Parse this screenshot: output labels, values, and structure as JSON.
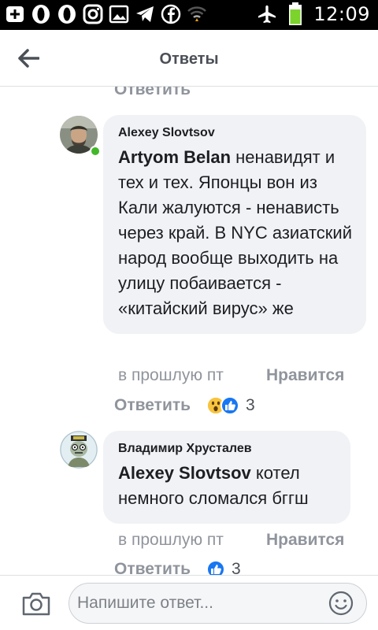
{
  "status_bar": {
    "time": "12:09",
    "icons": [
      "add-box-icon",
      "opera-icon",
      "opera-icon",
      "instagram-icon",
      "gallery-icon",
      "telegram-icon",
      "facebook-icon",
      "wifi-icon",
      "airplane-mode-icon",
      "battery-icon"
    ],
    "battery_color": "#7bd32b"
  },
  "header": {
    "title": "Ответы",
    "back_icon": "arrow-left-icon"
  },
  "thread": {
    "top_partial_reply": "Ответить",
    "comments": [
      {
        "author": "Alexey Slovtsov",
        "mention": "Artyom Belan",
        "text": " ненавидят и тех и тех. Японцы вон из Кали жалуются - ненависть через край. В NYC азиатский народ вообще выходить на улицу побаивается - «китайский вирус» же",
        "online": true,
        "time": "в прошлую пт",
        "like_label": "Нравится",
        "reply_label": "Ответить",
        "reactions": [
          "wow-reaction-icon",
          "like-reaction-icon"
        ],
        "reaction_count": "3"
      },
      {
        "author": "Владимир Хрусталев",
        "mention": "Alexey Slovtsov",
        "text": " котел немного сломался бггш",
        "online": false,
        "time": "в прошлую пт",
        "like_label": "Нравится",
        "reply_label": "Ответить",
        "reactions": [
          "like-reaction-icon"
        ],
        "reaction_count": "3"
      }
    ]
  },
  "composer": {
    "placeholder": "Напишите ответ...",
    "camera_icon": "camera-icon",
    "emoji_icon": "emoji-icon"
  },
  "colors": {
    "bubble": "#f0f2f5",
    "meta_text": "#90949c",
    "online": "#42b72a",
    "like_blue": "#1877f2",
    "wow_yellow": "#f7c43f"
  }
}
